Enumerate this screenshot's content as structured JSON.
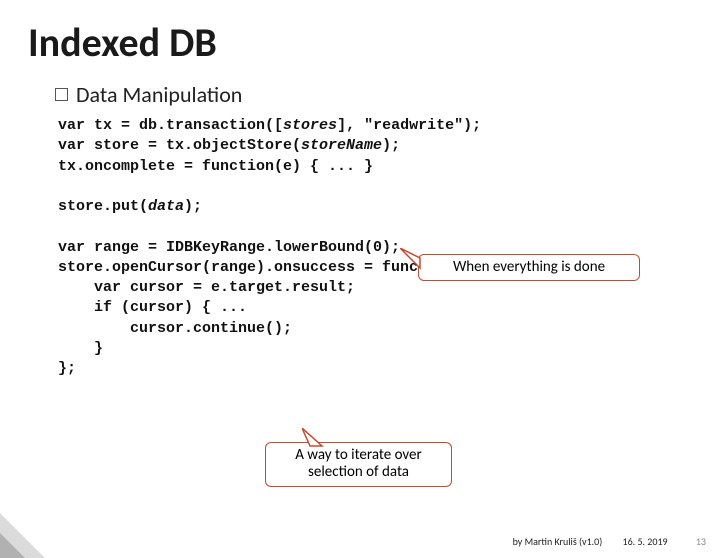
{
  "title": "Indexed DB",
  "bullet": "Data Manipulation",
  "code": {
    "l1a": "var tx = db.transaction([",
    "l1b": "stores",
    "l1c": "], \"readwrite\");",
    "l2a": "var store = tx.objectStore(",
    "l2b": "storeName",
    "l2c": ");",
    "l3": "tx.oncomplete = function(e) { ... }",
    "l4a": "store.put(",
    "l4b": "data",
    "l4c": ");",
    "l5": "var range = IDBKeyRange.lowerBound(0);",
    "l6": "store.openCursor(range).onsuccess = function(e) {",
    "l7": "    var cursor = e.target.result;",
    "l8": "    if (cursor) { ...",
    "l9": "        cursor.continue();",
    "l10": "    }",
    "l11": "};"
  },
  "callout1": "When everything is done",
  "callout2_l1": "A way to iterate over",
  "callout2_l2": "selection of data",
  "footer": {
    "byline": "by Martin Kruliš (v1.0)",
    "date": "16. 5. 2019",
    "page": "13"
  }
}
